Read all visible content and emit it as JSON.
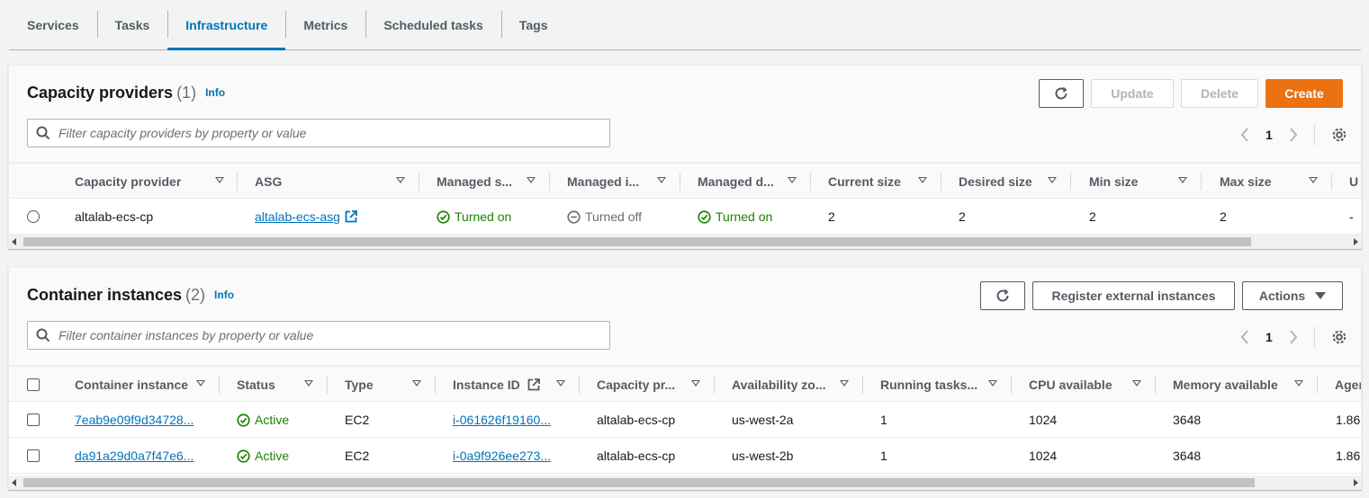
{
  "tabs": [
    {
      "label": "Services"
    },
    {
      "label": "Tasks"
    },
    {
      "label": "Infrastructure"
    },
    {
      "label": "Metrics"
    },
    {
      "label": "Scheduled tasks"
    },
    {
      "label": "Tags"
    }
  ],
  "capacity": {
    "title": "Capacity providers",
    "count": "(1)",
    "info": "Info",
    "buttons": {
      "update": "Update",
      "delete": "Delete",
      "create": "Create"
    },
    "filter_placeholder": "Filter capacity providers by property or value",
    "page": "1",
    "columns": [
      "Capacity provider",
      "ASG",
      "Managed s...",
      "Managed i...",
      "Managed d...",
      "Current size",
      "Desired size",
      "Min size",
      "Max size",
      "U"
    ],
    "rows": [
      {
        "name": "altalab-ecs-cp",
        "asg": "altalab-ecs-asg",
        "managed_scaling": "Turned on",
        "managed_instance": "Turned off",
        "managed_draining": "Turned on",
        "current_size": "2",
        "desired_size": "2",
        "min_size": "2",
        "max_size": "2",
        "update": "-"
      }
    ]
  },
  "instances": {
    "title": "Container instances",
    "count": "(2)",
    "info": "Info",
    "buttons": {
      "register": "Register external instances",
      "actions": "Actions"
    },
    "filter_placeholder": "Filter container instances by property or value",
    "page": "1",
    "columns": [
      "Container instance",
      "Status",
      "Type",
      "Instance ID",
      "Capacity pr...",
      "Availability zo...",
      "Running tasks...",
      "CPU available",
      "Memory available",
      "Agen"
    ],
    "rows": [
      {
        "instance": "7eab9e09f9d34728...",
        "status": "Active",
        "type": "EC2",
        "instance_id": "i-061626f19160...",
        "capacity_provider": "altalab-ecs-cp",
        "az": "us-west-2a",
        "running_tasks": "1",
        "cpu": "1024",
        "memory": "3648",
        "agent": "1.86"
      },
      {
        "instance": "da91a29d0a7f47e6...",
        "status": "Active",
        "type": "EC2",
        "instance_id": "i-0a9f926ee273...",
        "capacity_provider": "altalab-ecs-cp",
        "az": "us-west-2b",
        "running_tasks": "1",
        "cpu": "1024",
        "memory": "3648",
        "agent": "1.86"
      }
    ]
  },
  "colors": {
    "accent": "#0073bb",
    "primary_button": "#ec7211",
    "success": "#1d8102"
  }
}
